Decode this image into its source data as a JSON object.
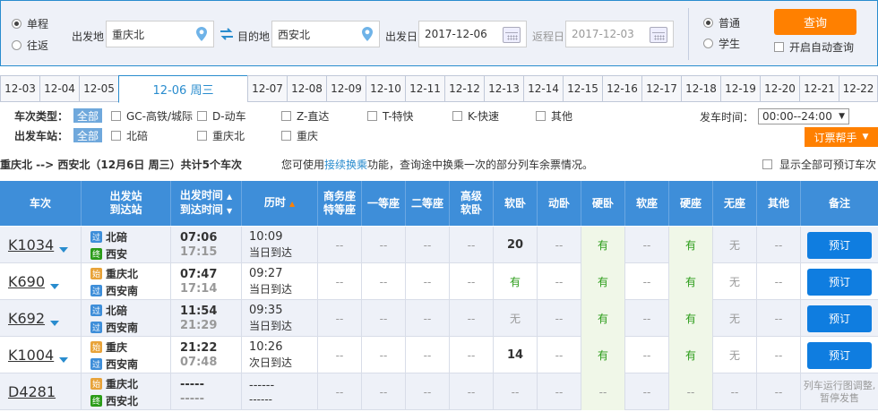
{
  "search": {
    "trip_types": [
      {
        "label": "单程",
        "selected": true
      },
      {
        "label": "往返",
        "selected": false
      }
    ],
    "from_label": "出发地",
    "from_value": "重庆北",
    "to_label": "目的地",
    "to_value": "西安北",
    "depart_label": "出发日",
    "depart_value": "2017-12-06",
    "return_label": "返程日",
    "return_value": "2017-12-03",
    "passenger_types": [
      {
        "label": "普通",
        "selected": true
      },
      {
        "label": "学生",
        "selected": false
      }
    ],
    "query_label": "查询",
    "auto_query_label": "开启自动查询"
  },
  "date_tabs": [
    "12-03",
    "12-04",
    "12-05",
    "12-06 周三",
    "12-07",
    "12-08",
    "12-09",
    "12-10",
    "12-11",
    "12-12",
    "12-13",
    "12-14",
    "12-15",
    "12-16",
    "12-17",
    "12-18",
    "12-19",
    "12-20",
    "12-21",
    "12-22"
  ],
  "active_tab_index": 3,
  "filters": {
    "type_label": "车次类型：",
    "type_all": "全部",
    "types": [
      "GC-高铁/城际",
      "D-动车",
      "Z-直达",
      "T-特快",
      "K-快速",
      "其他"
    ],
    "station_label": "出发车站：",
    "station_all": "全部",
    "stations": [
      "北碚",
      "重庆北",
      "重庆"
    ],
    "time_label": "发车时间：",
    "time_value": "00:00--24:00",
    "helper_label": "订票帮手"
  },
  "summary": {
    "route": "重庆北 --> 西安北（12月6日  周三）共计5个车次",
    "note_prefix": "您可使用",
    "note_link": "接续换乘",
    "note_suffix": "功能，查询途中换乘一次的部分列车余票情况。",
    "show_all": "显示全部可预订车次"
  },
  "headers": {
    "train": "车次",
    "stations_1": "出发站",
    "stations_2": "到达站",
    "times_1": "出发时间",
    "times_2": "到达时间",
    "duration": "历时",
    "business_1": "商务座",
    "business_2": "特等座",
    "first": "一等座",
    "second": "二等座",
    "adv_soft_1": "高级",
    "adv_soft_2": "软卧",
    "soft_sleeper": "软卧",
    "bullet_sleeper": "动卧",
    "hard_sleeper": "硬卧",
    "soft_seat": "软座",
    "hard_seat": "硬座",
    "no_seat": "无座",
    "other": "其他",
    "remark": "备注"
  },
  "rows": [
    {
      "train": "K1034",
      "from_badge": "过",
      "from": "北碚",
      "to_badge": "终",
      "to": "西安",
      "dep": "07:06",
      "arr": "17:15",
      "dur": "10:09",
      "day": "当日到达",
      "seats": [
        "--",
        "--",
        "--",
        "--",
        "20",
        "--",
        "有",
        "--",
        "有",
        "无",
        "--"
      ],
      "action": "预订"
    },
    {
      "train": "K690",
      "from_badge": "始",
      "from": "重庆北",
      "to_badge": "过",
      "to": "西安南",
      "dep": "07:47",
      "arr": "17:14",
      "dur": "09:27",
      "day": "当日到达",
      "seats": [
        "--",
        "--",
        "--",
        "--",
        "有",
        "--",
        "有",
        "--",
        "有",
        "无",
        "--"
      ],
      "action": "预订"
    },
    {
      "train": "K692",
      "from_badge": "过",
      "from": "北碚",
      "to_badge": "过",
      "to": "西安南",
      "dep": "11:54",
      "arr": "21:29",
      "dur": "09:35",
      "day": "当日到达",
      "seats": [
        "--",
        "--",
        "--",
        "--",
        "无",
        "--",
        "有",
        "--",
        "有",
        "无",
        "--"
      ],
      "action": "预订"
    },
    {
      "train": "K1004",
      "from_badge": "始",
      "from": "重庆",
      "to_badge": "过",
      "to": "西安南",
      "dep": "21:22",
      "arr": "07:48",
      "dur": "10:26",
      "day": "次日到达",
      "seats": [
        "--",
        "--",
        "--",
        "--",
        "14",
        "--",
        "有",
        "--",
        "有",
        "无",
        "--"
      ],
      "action": "预订"
    },
    {
      "train": "D4281",
      "from_badge": "始",
      "from": "重庆北",
      "to_badge": "终",
      "to": "西安北",
      "dep": "-----",
      "arr": "-----",
      "dur": "------",
      "day": "------",
      "seats": [
        "--",
        "--",
        "--",
        "--",
        "--",
        "--",
        "--",
        "--",
        "--",
        "--",
        "--"
      ],
      "remark": "列车运行图调整,暂停发售"
    }
  ]
}
